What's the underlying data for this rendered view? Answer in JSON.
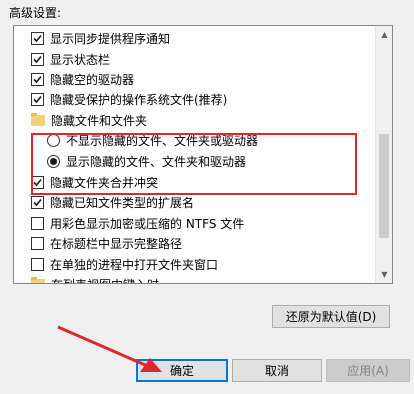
{
  "section_label": "高级设置:",
  "items": [
    {
      "type": "checkbox",
      "label": "显示同步提供程序通知",
      "checked": true
    },
    {
      "type": "checkbox",
      "label": "显示状态栏",
      "checked": true
    },
    {
      "type": "checkbox",
      "label": "隐藏空的驱动器",
      "checked": true
    },
    {
      "type": "checkbox",
      "label": "隐藏受保护的操作系统文件(推荐)",
      "checked": true
    },
    {
      "type": "folder",
      "label": "隐藏文件和文件夹"
    },
    {
      "type": "radio",
      "label": "不显示隐藏的文件、文件夹或驱动器",
      "selected": false
    },
    {
      "type": "radio",
      "label": "显示隐藏的文件、文件夹和驱动器",
      "selected": true
    },
    {
      "type": "checkbox",
      "label": "隐藏文件夹合并冲突",
      "checked": true
    },
    {
      "type": "checkbox",
      "label": "隐藏已知文件类型的扩展名",
      "checked": true
    },
    {
      "type": "checkbox",
      "label": "用彩色显示加密或压缩的 NTFS 文件",
      "checked": false
    },
    {
      "type": "checkbox",
      "label": "在标题栏中显示完整路径",
      "checked": false
    },
    {
      "type": "checkbox",
      "label": "在单独的进程中打开文件夹窗口",
      "checked": false
    },
    {
      "type": "folder",
      "label": "在列表视图中键入时"
    }
  ],
  "buttons": {
    "restore_defaults": "还原为默认值(D)",
    "ok": "确定",
    "cancel": "取消",
    "apply": "应用(A)"
  },
  "colors": {
    "highlight": "#e0262f",
    "annotation_arrow": "#e0262f"
  }
}
